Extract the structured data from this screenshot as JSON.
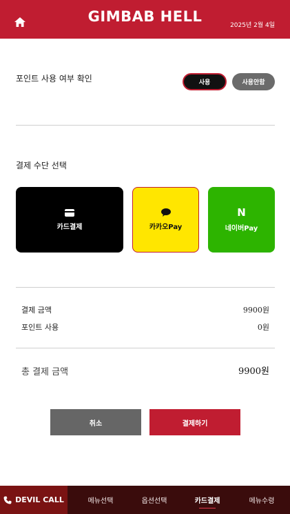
{
  "header": {
    "brand": "GIMBAB HELL",
    "date": "2025년 2월 4일",
    "home_icon": "home-icon"
  },
  "points": {
    "label": "포인트 사용 여부 확인",
    "use_label": "사용",
    "no_use_label": "사용안함",
    "selected": "사용"
  },
  "payment": {
    "label": "결제 수단 선택",
    "methods": [
      {
        "label": "카드결제",
        "icon": "credit-card-icon",
        "color": "#000000"
      },
      {
        "label": "카카오Pay",
        "icon": "chat-bubble-icon",
        "color": "#ffe600"
      },
      {
        "label": "네이버Pay",
        "icon": "naver-n-icon",
        "glyph": "N",
        "color": "#2db400"
      }
    ]
  },
  "summary": {
    "amount_label": "결제 금액",
    "amount_value": "9900원",
    "points_label": "포인트 사용",
    "points_value": "0원",
    "total_label": "총 결제 금액",
    "total_value": "9900원"
  },
  "actions": {
    "cancel_label": "취소",
    "pay_label": "결제하기"
  },
  "bottom_nav": {
    "call_label": "DEVIL CALL",
    "call_icon": "phone-icon",
    "items": [
      "메뉴선택",
      "옵션선택",
      "카드결제",
      "메뉴수령"
    ],
    "active": "카드결제"
  },
  "colors": {
    "brand": "#c01d31",
    "nav_bg": "#3a0c0c",
    "call_bg": "#7a1313"
  }
}
